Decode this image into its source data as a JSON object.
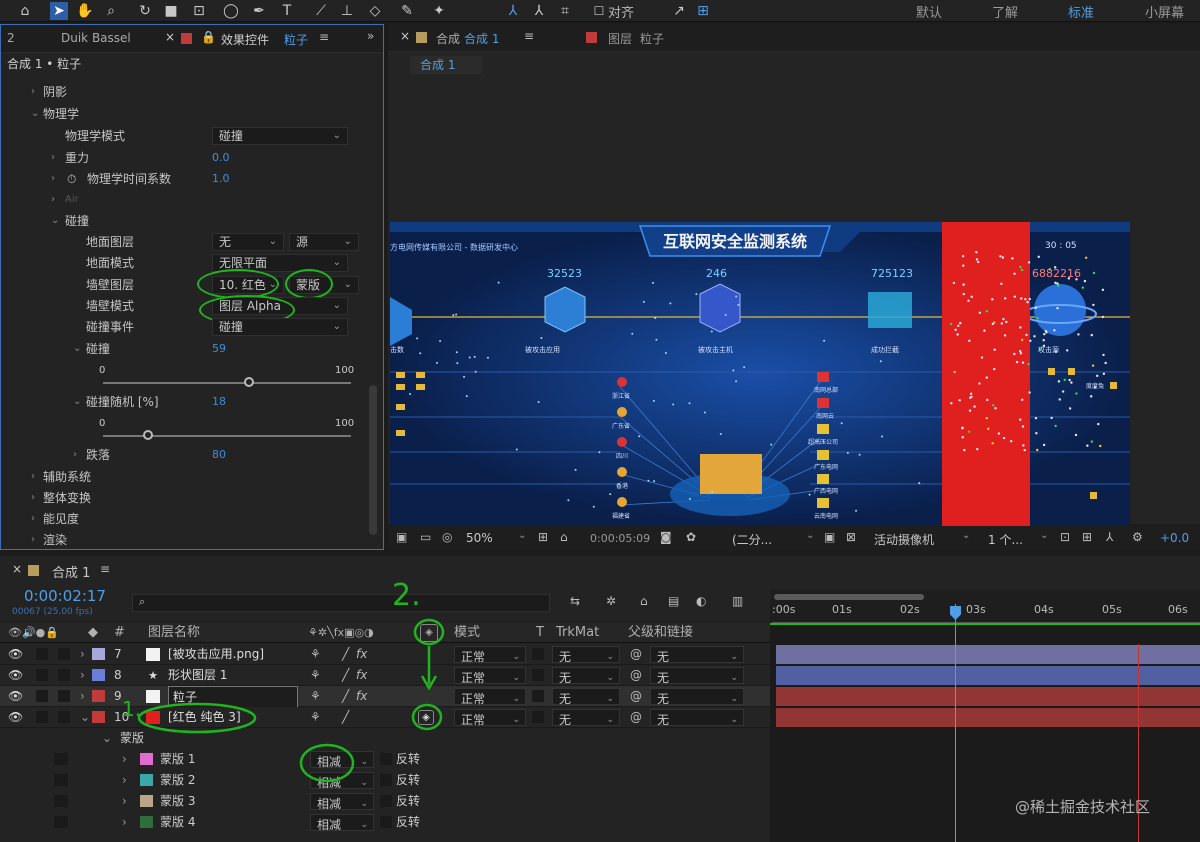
{
  "toolbar": {
    "align_label": "对齐",
    "workspaces": [
      "默认",
      "了解",
      "标准",
      "小屏幕"
    ],
    "active_workspace": "标准"
  },
  "effects_panel": {
    "tab_number": "2",
    "tab_duik": "Duik Bassel",
    "tab_effects": "效果控件",
    "tab_effects_layer": "粒子",
    "breadcrumb": "合成 1 • 粒子",
    "props": {
      "shadow": "阴影",
      "physics": "物理学",
      "physics_mode": "物理学模式",
      "physics_mode_value": "碰撞",
      "gravity": "重力",
      "gravity_value": "0.0",
      "time_factor": "物理学时间系数",
      "time_factor_value": "1.0",
      "air": "Air",
      "bounce": "碰撞",
      "floor_layer": "地面图层",
      "floor_layer_value": "无",
      "floor_layer_source": "源",
      "floor_mode": "地面模式",
      "floor_mode_value": "无限平面",
      "wall_layer": "墙壁图层",
      "wall_layer_value": "10. 红色",
      "wall_layer_source": "蒙版",
      "wall_mode": "墙壁模式",
      "wall_mode_value": "图层 Alpha",
      "collision_event": "碰撞事件",
      "collision_event_value": "碰撞",
      "bounce_amount": "碰撞",
      "bounce_amount_value": "59",
      "bounce_min": "0",
      "bounce_max": "100",
      "bounce_random": "碰撞随机 [%]",
      "bounce_random_value": "18",
      "random_min": "0",
      "random_max": "100",
      "slide": "跌落",
      "slide_value": "80",
      "aux_system": "辅助系统",
      "global_transform": "整体变换",
      "visibility": "能见度",
      "rendering": "渲染"
    },
    "bounce_level": 0.59,
    "random_level": 0.18
  },
  "comp_panel": {
    "tab_comp_label": "合成",
    "tab_comp_name": "合成 1",
    "tab_layer_label": "图层",
    "tab_layer_name": "粒子",
    "sub_tab": "合成 1",
    "canvas": {
      "title": "互联网安全监测系统",
      "company": "方电网传媒有限公司 - 数据研发中心",
      "clock": "30 : 05",
      "stats": [
        "32523",
        "246",
        "725123",
        "6882216"
      ],
      "node_labels": [
        "击数",
        "被攻击应用",
        "被攻击主机",
        "成功拦截",
        "攻击源"
      ],
      "left_regions": [
        "浙江省",
        "广东省",
        "四川",
        "香港",
        "福建省"
      ],
      "right_targets": [
        "南网总部",
        "南网云",
        "超高压公司",
        "广东电网",
        "广西电网",
        "云南电网"
      ],
      "attacker_label": "度度兔"
    },
    "viewer_bar": {
      "zoom": "50%",
      "timecode": "0:00:05:09",
      "resolution": "(二分...",
      "camera": "活动摄像机",
      "views": "1 个...",
      "exposure": "+0.0"
    }
  },
  "timeline": {
    "tab_name": "合成 1",
    "timecode": "0:00:02:17",
    "frame_info": "00067 (25.00 fps)",
    "ruler": [
      ":00s",
      "01s",
      "02s",
      "03s",
      "04s",
      "05s",
      "06s"
    ],
    "headers": {
      "layer_name": "图层名称",
      "mode": "模式",
      "t": "T",
      "trkmat": "TrkMat",
      "parent": "父级和链接"
    },
    "layers": [
      {
        "num": "7",
        "name": "[被攻击应用.png]",
        "mode": "正常",
        "trkmat": "无",
        "parent": "无",
        "color": "#a9a6d9"
      },
      {
        "num": "8",
        "name": "形状图层 1",
        "mode": "正常",
        "trkmat": "无",
        "parent": "无",
        "color": "#6b7fd9"
      },
      {
        "num": "9",
        "name": "粒子",
        "mode": "正常",
        "trkmat": "无",
        "parent": "无",
        "color": "#c23b3b"
      },
      {
        "num": "10",
        "name": "[红色 纯色 3]",
        "mode": "正常",
        "trkmat": "无",
        "parent": "无",
        "color": "#c23b3b"
      }
    ],
    "masks_group": "蒙版",
    "masks": [
      {
        "name": "蒙版 1",
        "mode": "相减",
        "invert": "反转",
        "color": "#e26bd2"
      },
      {
        "name": "蒙版 2",
        "mode": "相减",
        "invert": "反转",
        "color": "#3aa8a8"
      },
      {
        "name": "蒙版 3",
        "mode": "相减",
        "invert": "反转",
        "color": "#b8a58a"
      },
      {
        "name": "蒙版 4",
        "mode": "相减",
        "invert": "反转",
        "color": "#2f6d3a"
      }
    ],
    "annotations": {
      "step1": "1.",
      "step2": "2."
    },
    "playhead_time": "02s17f"
  },
  "watermark": "@稀土掘金技术社区"
}
